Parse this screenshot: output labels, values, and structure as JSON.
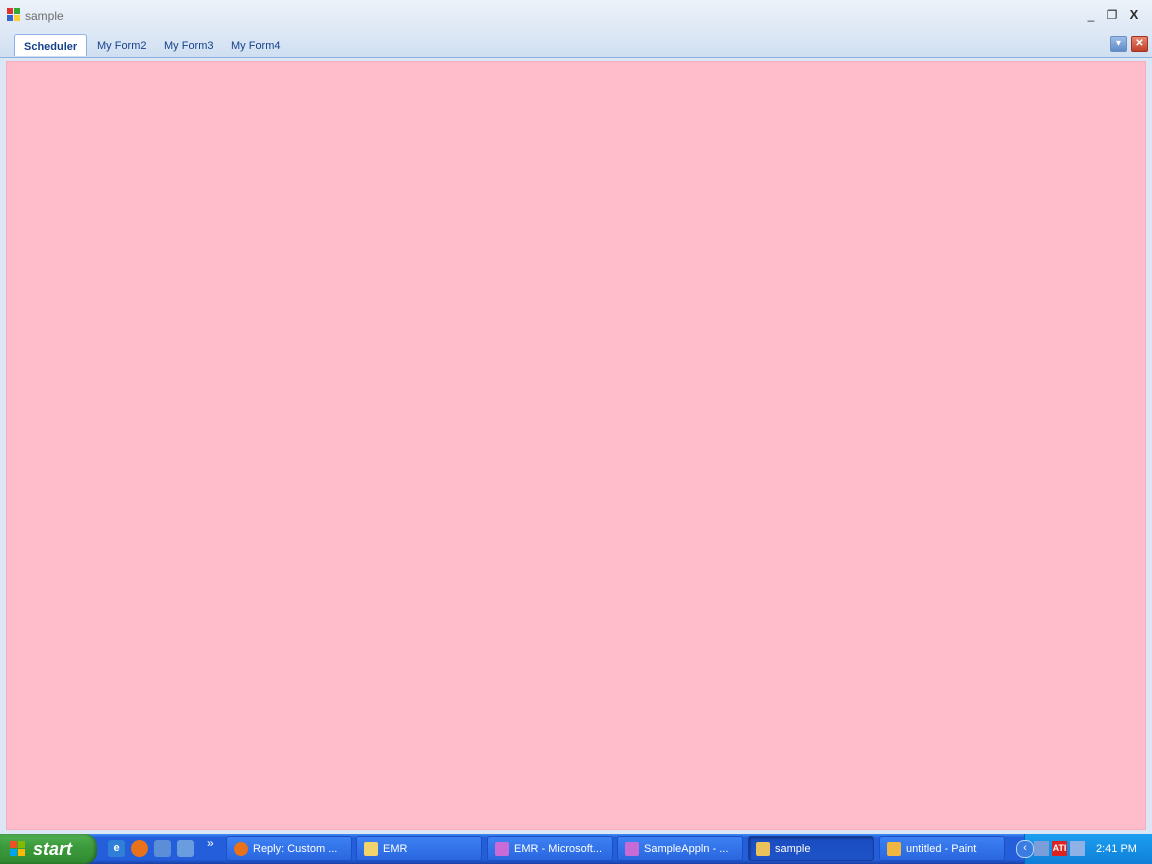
{
  "window": {
    "title": "sample",
    "controls": {
      "minimize": "_",
      "maximize": "❐",
      "close": "X"
    }
  },
  "tabs": [
    {
      "label": "Scheduler",
      "active": true
    },
    {
      "label": "My Form2",
      "active": false
    },
    {
      "label": "My Form3",
      "active": false
    },
    {
      "label": "My Form4",
      "active": false
    }
  ],
  "tab_buttons": {
    "list_glyph": "▾",
    "close_glyph": "✕"
  },
  "content": {
    "background_color": "#ffbccb"
  },
  "taskbar": {
    "start_label": "start",
    "quick_launch_icons": [
      "internet-explorer-icon",
      "firefox-icon",
      "show-desktop-icon",
      "outlook-icon"
    ],
    "quick_launch_more": "»",
    "tasks": [
      {
        "label": "Reply: Custom ...",
        "icon": "firefox-icon",
        "active": false
      },
      {
        "label": "EMR",
        "icon": "folder-icon",
        "active": false
      },
      {
        "label": "EMR - Microsoft...",
        "icon": "visual-studio-icon",
        "active": false
      },
      {
        "label": "SampleAppln - ...",
        "icon": "visual-studio-icon",
        "active": false
      },
      {
        "label": "sample",
        "icon": "app-window-icon",
        "active": true
      },
      {
        "label": "untitled - Paint",
        "icon": "paint-icon",
        "active": false
      }
    ],
    "tray": {
      "expand_glyph": "‹",
      "icons": [
        "display-icon",
        "ati-icon",
        "network-icon"
      ],
      "ati_text": "ATI",
      "time": "2:41 PM"
    }
  }
}
